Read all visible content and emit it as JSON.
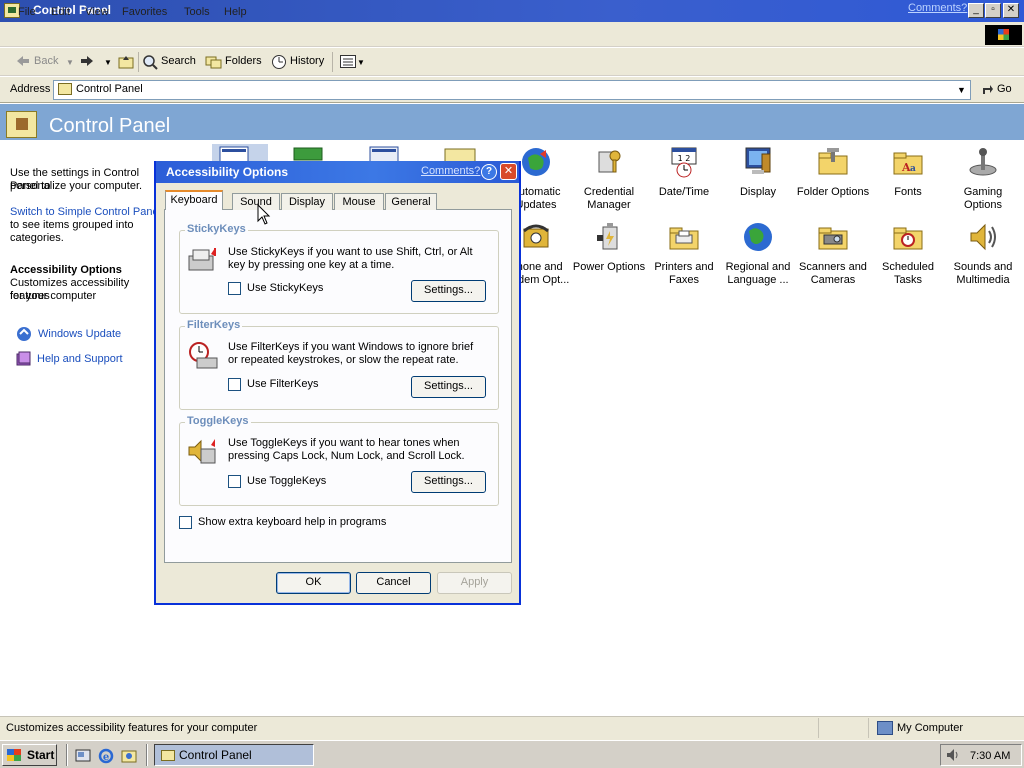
{
  "window": {
    "title": "Control Panel",
    "comments_link": "Comments?",
    "min_label": "_",
    "max_label": "▫",
    "close_label": "✕"
  },
  "menu": [
    "File",
    "Edit",
    "View",
    "Favorites",
    "Tools",
    "Help"
  ],
  "toolbar": {
    "back": "Back",
    "search": "Search",
    "folders": "Folders",
    "history": "History"
  },
  "address": {
    "label": "Address",
    "value": "Control Panel",
    "go": "Go"
  },
  "header": {
    "title": "Control Panel"
  },
  "left_pane": {
    "intro_1": "Use the settings in Control Panel to",
    "intro_2": "personalize your computer.",
    "switch_link": "Switch to Simple Control Panel",
    "switch_rest_1": "to see items grouped into",
    "switch_rest_2": "categories.",
    "selected_title": "Accessibility Options",
    "selected_desc_1": "Customizes accessibility features",
    "selected_desc_2": "for your computer",
    "links": [
      "Windows Update",
      "Help and Support"
    ]
  },
  "items_row1": [
    {
      "line1": "Automatic",
      "line2": "Updates",
      "icon": "automatic-updates-icon"
    },
    {
      "line1": "Credential",
      "line2": "Manager",
      "icon": "credential-manager-icon"
    },
    {
      "line1": "Date/Time",
      "line2": "",
      "icon": "date-time-icon"
    },
    {
      "line1": "Display",
      "line2": "",
      "icon": "display-icon"
    },
    {
      "line1": "Folder Options",
      "line2": "",
      "icon": "folder-options-icon"
    },
    {
      "line1": "Fonts",
      "line2": "",
      "icon": "fonts-icon"
    },
    {
      "line1": "Gaming",
      "line2": "Options",
      "icon": "gaming-options-icon"
    }
  ],
  "items_row2": [
    {
      "line1": "Phone and",
      "line2": "Modem Opt...",
      "icon": "phone-modem-icon"
    },
    {
      "line1": "Power Options",
      "line2": "",
      "icon": "power-options-icon"
    },
    {
      "line1": "Printers and",
      "line2": "Faxes",
      "icon": "printers-faxes-icon"
    },
    {
      "line1": "Regional and",
      "line2": "Language ...",
      "icon": "regional-language-icon"
    },
    {
      "line1": "Scanners and",
      "line2": "Cameras",
      "icon": "scanners-cameras-icon"
    },
    {
      "line1": "Scheduled",
      "line2": "Tasks",
      "icon": "scheduled-tasks-icon"
    },
    {
      "line1": "Sounds and",
      "line2": "Multimedia",
      "icon": "sounds-multimedia-icon"
    }
  ],
  "status": {
    "text": "Customizes accessibility features for your computer",
    "zone": "My Computer"
  },
  "taskbar": {
    "start": "Start",
    "task": "Control Panel",
    "clock": "7:30 AM"
  },
  "dialog": {
    "title": "Accessibility Options",
    "comments_link": "Comments?",
    "help": "?",
    "close": "✕",
    "tabs": [
      "Keyboard",
      "Sound",
      "Display",
      "Mouse",
      "General"
    ],
    "active_tab": "Keyboard",
    "stickykeys": {
      "label": "StickyKeys",
      "desc": "Use StickyKeys if you want to use Shift, Ctrl, or Alt key by pressing one key at a time.",
      "checkbox": "Use StickyKeys",
      "checked": false,
      "button": "Settings..."
    },
    "filterkeys": {
      "label": "FilterKeys",
      "desc": "Use FilterKeys if you want Windows to ignore brief or repeated keystrokes, or slow the repeat rate.",
      "checkbox": "Use FilterKeys",
      "checked": false,
      "button": "Settings..."
    },
    "togglekeys": {
      "label": "ToggleKeys",
      "desc": "Use ToggleKeys if you want to hear tones when pressing Caps Lock, Num Lock, and Scroll Lock.",
      "checkbox": "Use ToggleKeys",
      "checked": false,
      "button": "Settings..."
    },
    "extra_help": "Show extra keyboard help in programs",
    "ok": "OK",
    "cancel": "Cancel",
    "apply": "Apply"
  }
}
